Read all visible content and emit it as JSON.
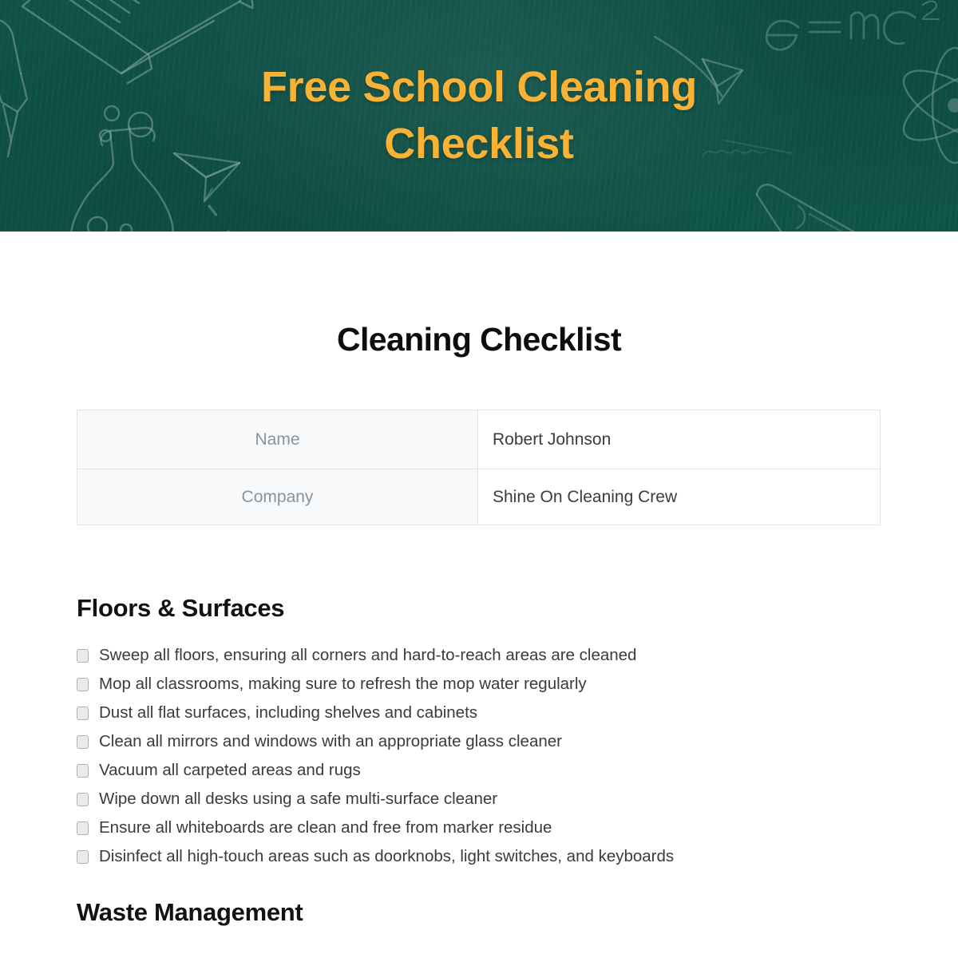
{
  "banner": {
    "title": "Free School Cleaning\nChecklist",
    "background_color": "#0f5449",
    "title_color": "#f9b233",
    "doodles": [
      "book-doodle",
      "pencil-doodle",
      "flask-doodle",
      "paper-airplane-doodle",
      "atom-doodle",
      "emc2-formula-doodle"
    ],
    "formula_text": "e = mc"
  },
  "document": {
    "heading": "Cleaning Checklist"
  },
  "info_table": {
    "rows": [
      {
        "label": "Name",
        "value": "Robert Johnson"
      },
      {
        "label": "Company",
        "value": "Shine On Cleaning Crew"
      }
    ]
  },
  "sections": [
    {
      "title": "Floors & Surfaces",
      "items": [
        "Sweep all floors, ensuring all corners and hard-to-reach areas are cleaned",
        "Mop all classrooms, making sure to refresh the mop water regularly",
        "Dust all flat surfaces, including shelves and cabinets",
        "Clean all mirrors and windows with an appropriate glass cleaner",
        "Vacuum all carpeted areas and rugs",
        "Wipe down all desks using a safe multi-surface cleaner",
        "Ensure all whiteboards are clean and free from marker residue",
        "Disinfect all high-touch areas such as doorknobs, light switches, and keyboards"
      ]
    },
    {
      "title": "Waste Management",
      "items": []
    }
  ]
}
